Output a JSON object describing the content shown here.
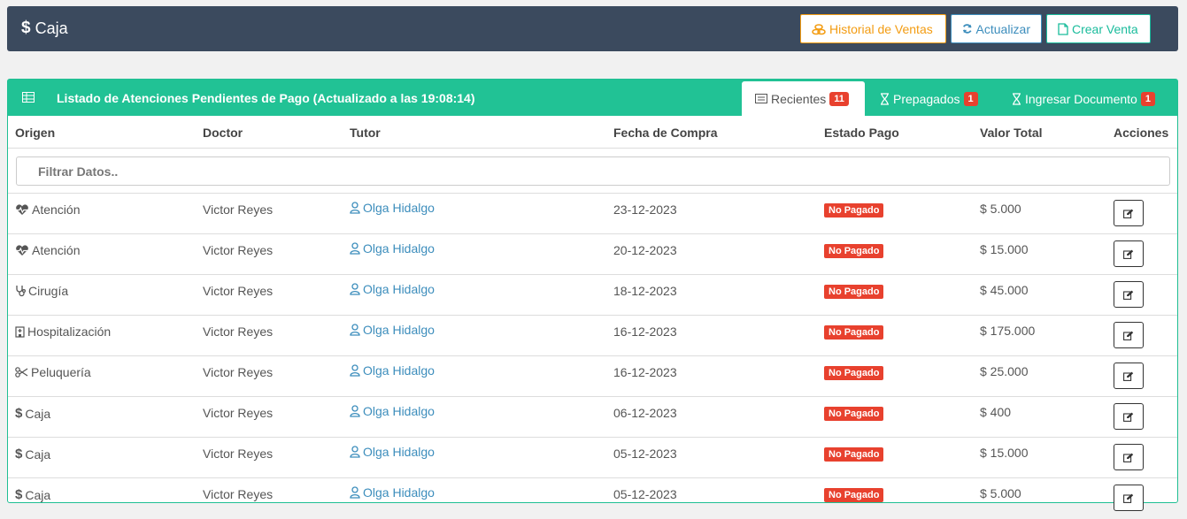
{
  "header": {
    "title": "Caja",
    "buttons": {
      "historial": "Historial de Ventas",
      "actualizar": "Actualizar",
      "crear": "Crear Venta"
    }
  },
  "panel": {
    "title": "Listado de Atenciones Pendientes de Pago (Actualizado a las 19:08:14)",
    "tabs": [
      {
        "label": "Recientes",
        "count": "11"
      },
      {
        "label": "Prepagados",
        "count": "1"
      },
      {
        "label": "Ingresar Documento",
        "count": "1"
      }
    ],
    "columns": [
      "Origen",
      "Doctor",
      "Tutor",
      "Fecha de Compra",
      "Estado Pago",
      "Valor Total",
      "Acciones"
    ],
    "filter_placeholder": "Filtrar Datos..",
    "rows": [
      {
        "origen": "Atención",
        "icon": "heartbeat-icon",
        "doctor": "Victor Reyes",
        "tutor": "Olga Hidalgo",
        "fecha": "23-12-2023",
        "estado": "No Pagado",
        "valor": "$ 5.000"
      },
      {
        "origen": "Atención",
        "icon": "heartbeat-icon",
        "doctor": "Victor Reyes",
        "tutor": "Olga Hidalgo",
        "fecha": "20-12-2023",
        "estado": "No Pagado",
        "valor": "$ 15.000"
      },
      {
        "origen": "Cirugía",
        "icon": "stethoscope-icon",
        "doctor": "Victor Reyes",
        "tutor": "Olga Hidalgo",
        "fecha": "18-12-2023",
        "estado": "No Pagado",
        "valor": "$ 45.000"
      },
      {
        "origen": "Hospitalización",
        "icon": "hospital-icon",
        "doctor": "Victor Reyes",
        "tutor": "Olga Hidalgo",
        "fecha": "16-12-2023",
        "estado": "No Pagado",
        "valor": "$ 175.000"
      },
      {
        "origen": "Peluquería",
        "icon": "scissors-icon",
        "doctor": "Victor Reyes",
        "tutor": "Olga Hidalgo",
        "fecha": "16-12-2023",
        "estado": "No Pagado",
        "valor": "$ 25.000"
      },
      {
        "origen": "Caja",
        "icon": "dollar-icon",
        "doctor": "Victor Reyes",
        "tutor": "Olga Hidalgo",
        "fecha": "06-12-2023",
        "estado": "No Pagado",
        "valor": "$ 400"
      },
      {
        "origen": "Caja",
        "icon": "dollar-icon",
        "doctor": "Victor Reyes",
        "tutor": "Olga Hidalgo",
        "fecha": "05-12-2023",
        "estado": "No Pagado",
        "valor": "$ 15.000"
      },
      {
        "origen": "Caja",
        "icon": "dollar-icon",
        "doctor": "Victor Reyes",
        "tutor": "Olga Hidalgo",
        "fecha": "05-12-2023",
        "estado": "No Pagado",
        "valor": "$ 5.000"
      }
    ]
  },
  "colors": {
    "topbar": "#3b4a5e",
    "panel_header": "#21c295",
    "badge": "#e8412e",
    "link": "#3c8dbc",
    "warning": "#f39c12"
  }
}
